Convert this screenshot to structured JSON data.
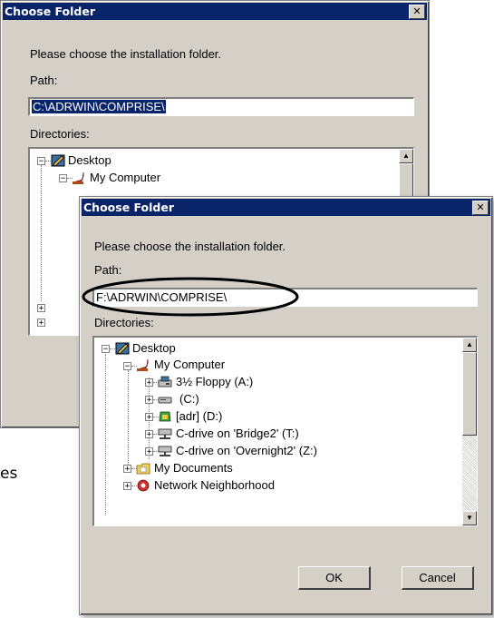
{
  "back_dialog": {
    "title": "Choose Folder",
    "close_glyph": "✕",
    "prompt": "Please choose the installation folder.",
    "path_label": "Path:",
    "path_value": "C:\\ADRWIN\\COMPRISE\\",
    "directories_label": "Directories:",
    "tree": [
      {
        "label": "Desktop",
        "icon": "desktop-icon"
      },
      {
        "label": "My Computer",
        "icon": "computer-icon"
      }
    ]
  },
  "front_dialog": {
    "title": "Choose Folder",
    "close_glyph": "✕",
    "prompt": "Please choose the installation folder.",
    "path_label": "Path:",
    "path_value": "F:\\ADRWIN\\COMPRISE\\",
    "directories_label": "Directories:",
    "tree": [
      {
        "label": "Desktop",
        "icon": "desktop-icon"
      },
      {
        "label": "My Computer",
        "icon": "computer-icon"
      },
      {
        "label": "3½ Floppy (A:)",
        "icon": "floppy-icon"
      },
      {
        "label": "(C:)",
        "icon": "hard-drive-icon"
      },
      {
        "label": "[adr] (D:)",
        "icon": "cd-drive-icon"
      },
      {
        "label": "C-drive on 'Bridge2' (T:)",
        "icon": "network-drive-icon"
      },
      {
        "label": "C-drive on 'Overnight2' (Z:)",
        "icon": "network-drive-icon"
      },
      {
        "label": "My Documents",
        "icon": "documents-folder-icon"
      },
      {
        "label": "Network Neighborhood",
        "icon": "network-neighborhood-icon"
      }
    ],
    "ok_label": "OK",
    "cancel_label": "Cancel"
  },
  "background_fragment": "es",
  "colors": {
    "dialog_face": "#d4d0c8",
    "titlebar": "#0a246a",
    "selection": "#0a246a",
    "annotation_ellipse": "#000000"
  }
}
